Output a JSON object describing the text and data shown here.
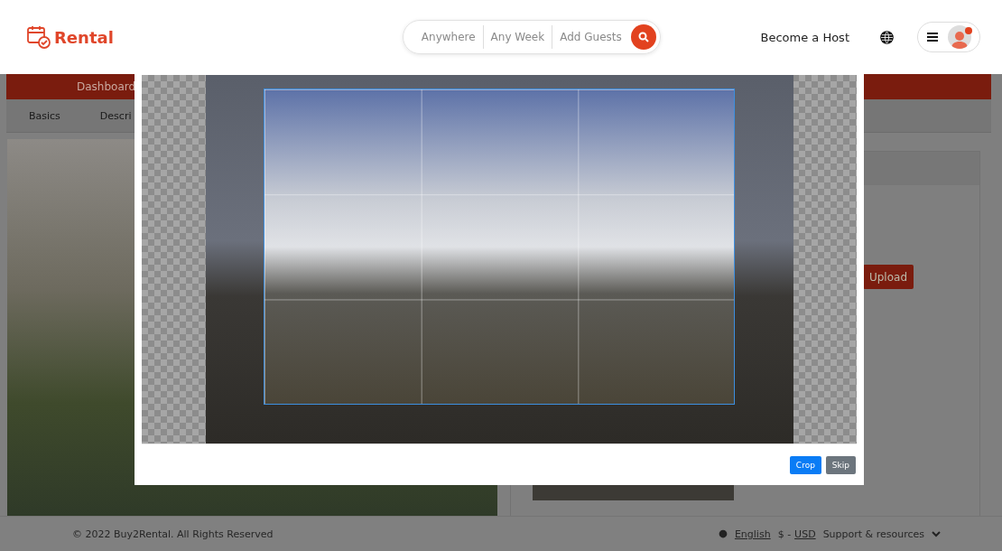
{
  "header": {
    "logo": "Rental",
    "search": {
      "segments": [
        "Anywhere",
        "Any Week",
        "Add Guests"
      ]
    },
    "host_link": "Become a Host",
    "has_notification": true
  },
  "dashboard_bar": {
    "label": "Dashboard"
  },
  "tabs": [
    {
      "label": "Basics"
    },
    {
      "label": "Descri"
    }
  ],
  "upload_button": "Upload",
  "crop_dialog": {
    "buttons": [
      {
        "label": "Crop",
        "kind": "primary"
      },
      {
        "label": "Skip",
        "kind": "secondary"
      }
    ]
  },
  "footer": {
    "copyright": "© 2022 Buy2Rental. All Rights Reserved",
    "language": "English",
    "currency_prefix": "$ -",
    "currency": "USD",
    "support": "Support & resources"
  }
}
